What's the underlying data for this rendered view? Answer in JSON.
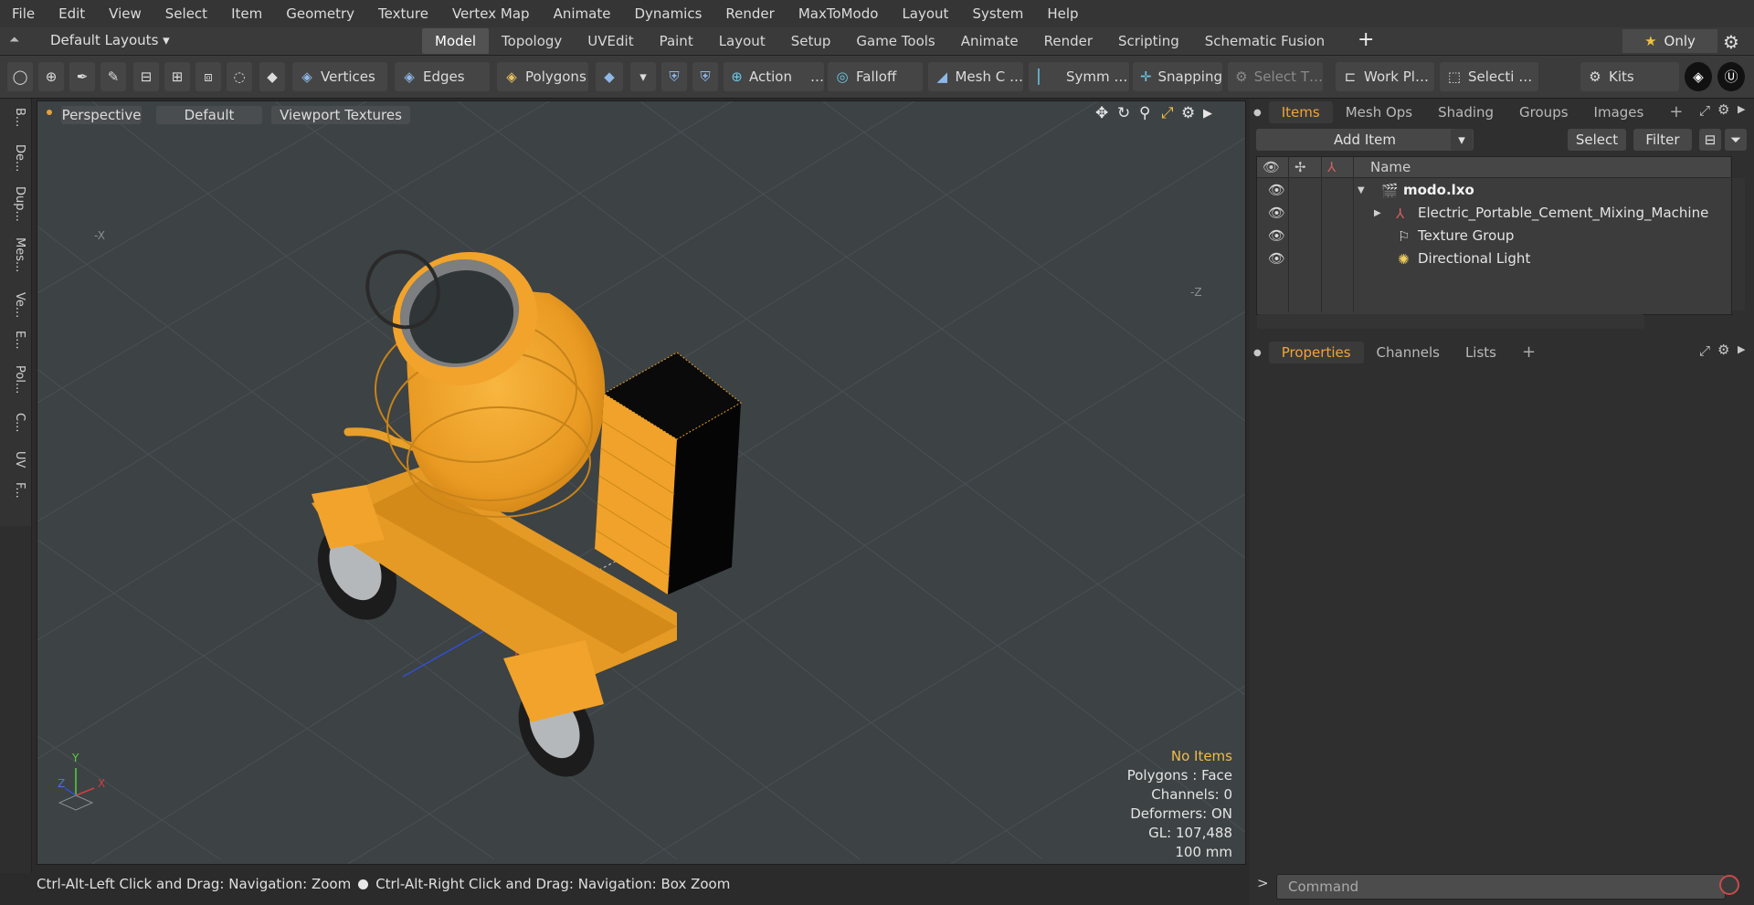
{
  "menu": [
    "File",
    "Edit",
    "View",
    "Select",
    "Item",
    "Geometry",
    "Texture",
    "Vertex Map",
    "Animate",
    "Dynamics",
    "Render",
    "MaxToModo",
    "Layout",
    "System",
    "Help"
  ],
  "layout_select": "Default Layouts ▾",
  "mode_tabs": [
    "Model",
    "Topology",
    "UVEdit",
    "Paint",
    "Layout",
    "Setup",
    "Game Tools",
    "Animate",
    "Render",
    "Scripting",
    "Schematic Fusion"
  ],
  "active_mode_tab": "Model",
  "only_label": "Only",
  "toolbar": {
    "vertices": "Vertices",
    "edges": "Edges",
    "polygons": "Polygons",
    "action": "Action",
    "action_more": "…",
    "falloff": "Falloff",
    "mesh": "Mesh C …",
    "symmetry": "Symm …",
    "snapping": "Snapping",
    "select_t": "Select T…",
    "workplane": "Work Pl…",
    "selection": "Selecti …",
    "kits": "Kits"
  },
  "left_tabs": [
    "B...",
    "De...",
    "Dup...",
    "Mes...",
    "Ve...",
    "E...",
    "Pol...",
    "C...",
    "UV",
    "F..."
  ],
  "viewport": {
    "view_mode": "Perspective",
    "shading": "Default",
    "textures": "Viewport Textures",
    "axis_neg_x": "-X",
    "axis_neg_z": "-Z",
    "gizmo_y": "Y",
    "gizmo_x": "X",
    "gizmo_z": "Z",
    "stats": {
      "no_items": "No Items",
      "polygons": "Polygons : Face",
      "channels": "Channels: 0",
      "deformers": "Deformers: ON",
      "gl": "GL: 107,488",
      "scale": "100 mm"
    }
  },
  "status": {
    "left": "Ctrl-Alt-Left Click and Drag: Navigation: Zoom",
    "right": "Ctrl-Alt-Right Click and Drag: Navigation: Box Zoom"
  },
  "items_panel": {
    "tabs": [
      "Items",
      "Mesh Ops",
      "Shading",
      "Groups",
      "Images"
    ],
    "active_tab": "Items",
    "add_item": "Add Item",
    "select_btn": "Select",
    "filter_btn": "Filter",
    "col_name": "Name",
    "rows": [
      {
        "name": "modo.lxo"
      },
      {
        "name": "Electric_Portable_Cement_Mixing_Machine"
      },
      {
        "name": "Texture Group"
      },
      {
        "name": "Directional Light"
      }
    ]
  },
  "props_panel": {
    "tabs": [
      "Properties",
      "Channels",
      "Lists"
    ],
    "active_tab": "Properties"
  },
  "command": {
    "placeholder": "Command",
    "prompt": ">"
  },
  "colors": {
    "accent": "#f0a43a",
    "mixer_orange": "#f2a32b",
    "viewport_bg": "#3d4244"
  }
}
